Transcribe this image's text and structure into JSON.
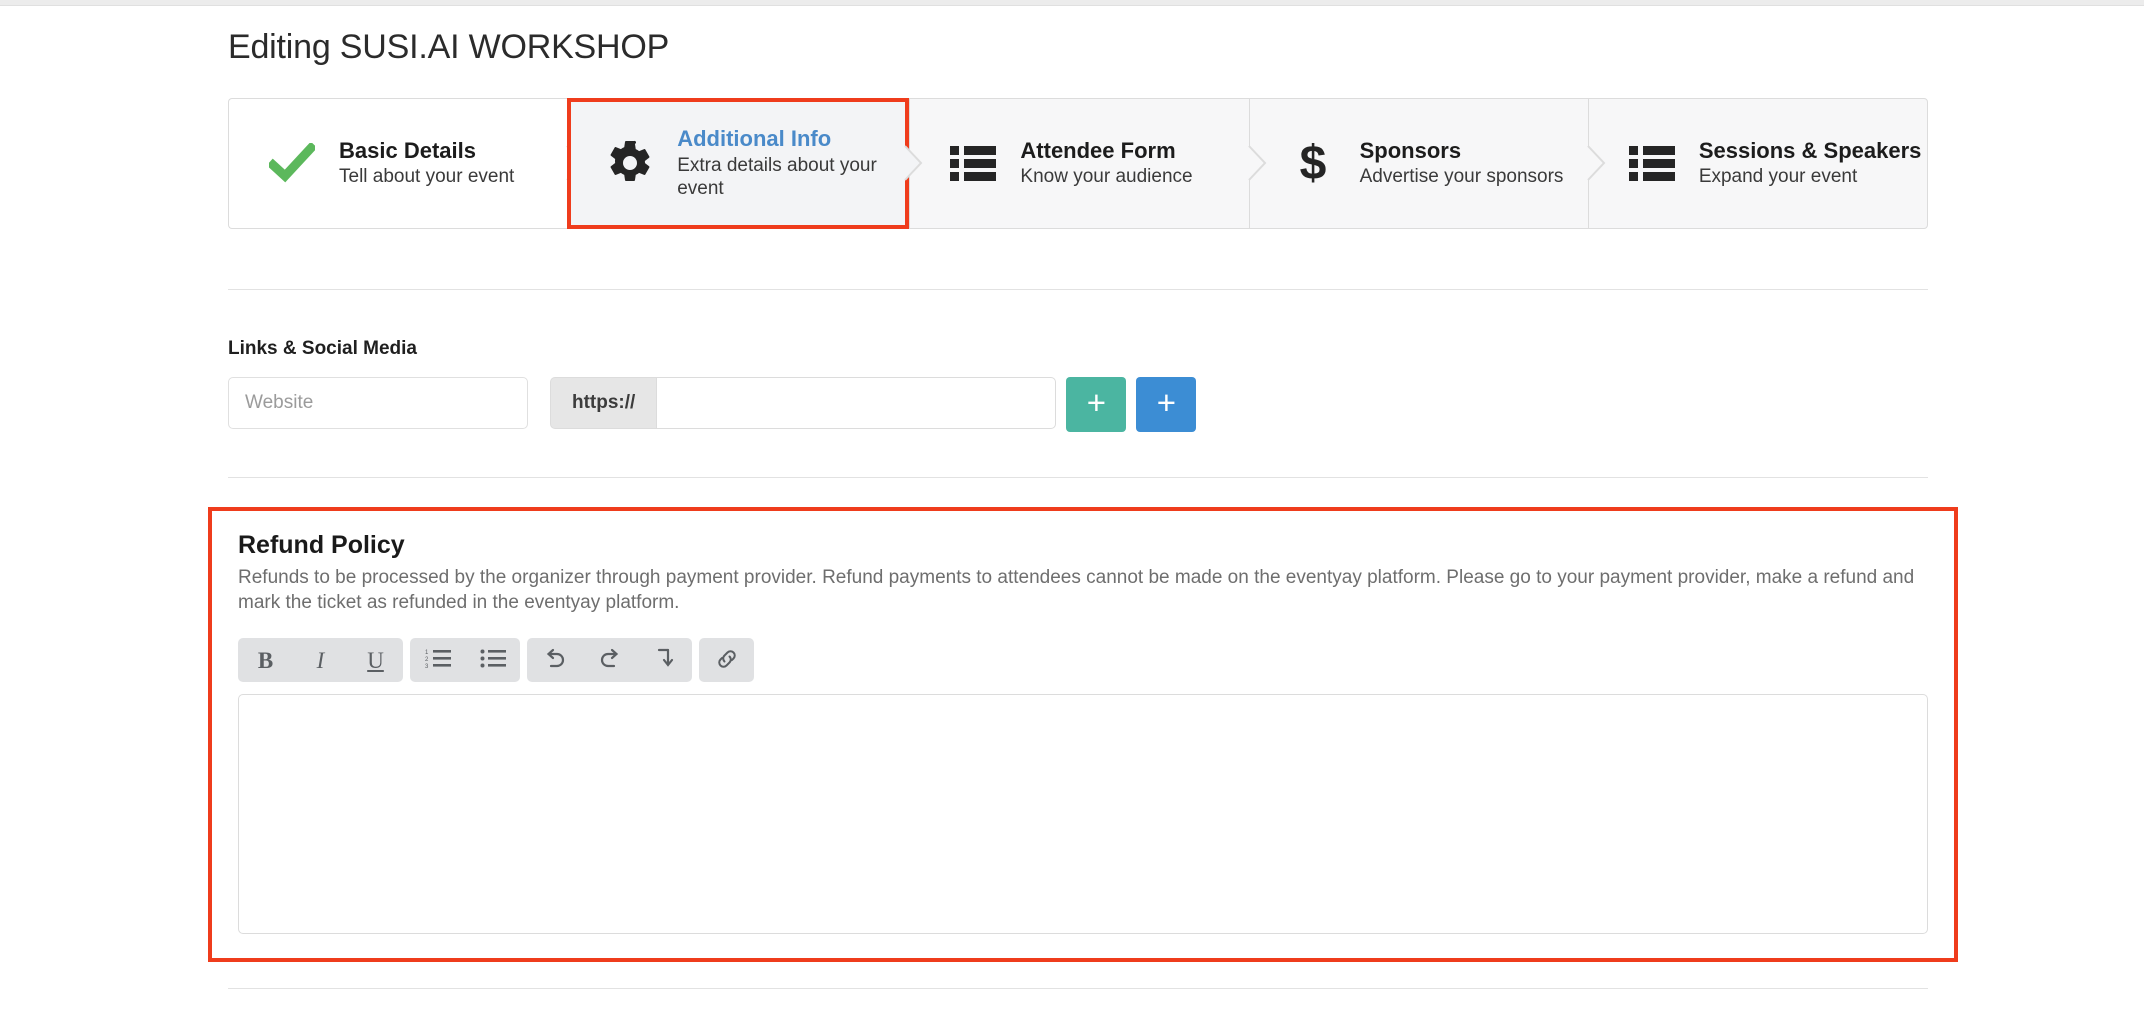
{
  "page": {
    "title": "Editing SUSI.AI WORKSHOP"
  },
  "colors": {
    "highlight": "#ef3c1c",
    "active_step_text": "#4a8ac9",
    "check_green": "#5cb85c",
    "add_teal": "#4bb5a1",
    "add_blue": "#3c8dd4"
  },
  "steps": [
    {
      "title": "Basic Details",
      "subtitle": "Tell about your event",
      "icon": "check-icon",
      "state": "completed"
    },
    {
      "title": "Additional Info",
      "subtitle": "Extra details about your event",
      "icon": "gear-icon",
      "state": "current"
    },
    {
      "title": "Attendee Form",
      "subtitle": "Know your audience",
      "icon": "list-icon",
      "state": "upcoming"
    },
    {
      "title": "Sponsors",
      "subtitle": "Advertise your sponsors",
      "icon": "dollar-icon",
      "state": "upcoming"
    },
    {
      "title": "Sessions & Speakers",
      "subtitle": "Expand your event",
      "icon": "list-icon",
      "state": "upcoming"
    }
  ],
  "links_section": {
    "label": "Links & Social Media",
    "website": {
      "placeholder": "Website",
      "value": ""
    },
    "url_prefix": "https://",
    "url_field": {
      "placeholder": "",
      "value": ""
    },
    "add_buttons": [
      {
        "label": "+",
        "name": "add-social-link-button",
        "color": "#4bb5a1"
      },
      {
        "label": "+",
        "name": "add-another-link-button",
        "color": "#3c8dd4"
      }
    ]
  },
  "refund_policy": {
    "title": "Refund Policy",
    "description": "Refunds to be processed by the organizer through payment provider. Refund payments to attendees cannot be made on the eventyay platform. Please go to your payment provider, make a refund and mark the ticket as refunded in the eventyay platform.",
    "editor": {
      "value": "",
      "toolbar_groups": [
        [
          {
            "name": "bold-icon",
            "label": "B"
          },
          {
            "name": "italic-icon",
            "label": "I"
          },
          {
            "name": "underline-icon",
            "label": "U"
          }
        ],
        [
          {
            "name": "ordered-list-icon",
            "label": ""
          },
          {
            "name": "bullet-list-icon",
            "label": ""
          }
        ],
        [
          {
            "name": "undo-icon",
            "label": ""
          },
          {
            "name": "redo-icon",
            "label": ""
          },
          {
            "name": "clear-formatting-icon",
            "label": ""
          }
        ],
        [
          {
            "name": "link-icon",
            "label": ""
          }
        ]
      ]
    }
  }
}
